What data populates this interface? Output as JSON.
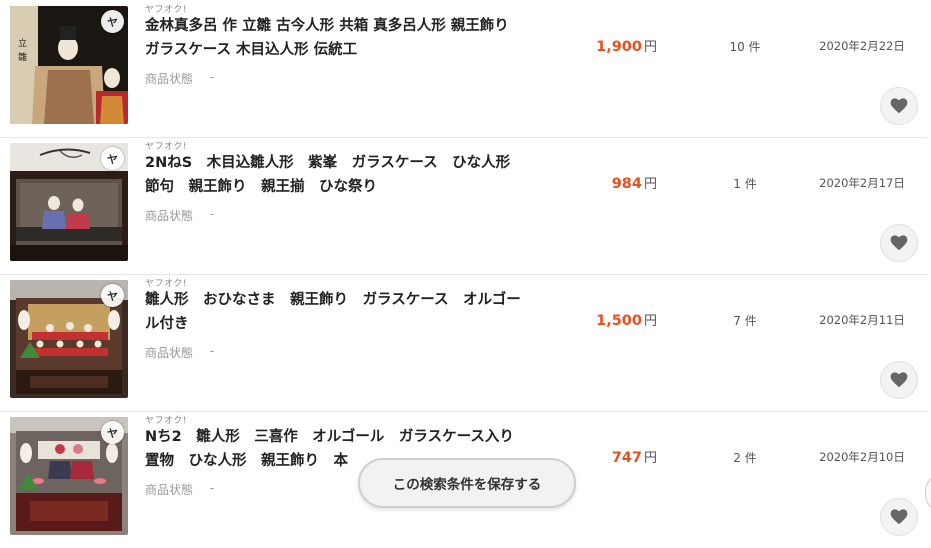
{
  "listings": [
    {
      "source": "ヤフオク!",
      "title": "金林真多呂 作 立雛 古今人形 共箱 真多呂人形 親王飾り\nガラスケース 木目込人形 伝統工",
      "condition_label": "商品状態",
      "condition_value": "-",
      "price": "1,900",
      "currency": "円",
      "bids": "10 件",
      "date": "2020年2月22日"
    },
    {
      "source": "ヤフオク!",
      "title": "2NねS　木目込雛人形　紫峯　ガラスケース　ひな人形\n節句　親王飾り　親王揃　ひな祭り",
      "condition_label": "商品状態",
      "condition_value": "-",
      "price": "984",
      "currency": "円",
      "bids": "1 件",
      "date": "2020年2月17日"
    },
    {
      "source": "ヤフオク!",
      "title": "雛人形　おひなさま　親王飾り　ガラスケース　オルゴー\nル付き",
      "condition_label": "商品状態",
      "condition_value": "-",
      "price": "1,500",
      "currency": "円",
      "bids": "7 件",
      "date": "2020年2月11日"
    },
    {
      "source": "ヤフオク!",
      "title": "Nち2　雛人形　三喜作　オルゴール　ガラスケース入り\n置物　ひな人形　親王飾り　本",
      "condition_label": "商品状態",
      "condition_value": "-",
      "price": "747",
      "currency": "円",
      "bids": "2 件",
      "date": "2020年2月10日"
    }
  ],
  "badge_text": "ヤ",
  "save_search_label": "この検索条件を保存する",
  "icons": {
    "favorite": "heart-icon",
    "source_badge": "yahuoku-badge-icon"
  },
  "colors": {
    "price": "#e6501e",
    "divider": "#e6e6e6"
  }
}
